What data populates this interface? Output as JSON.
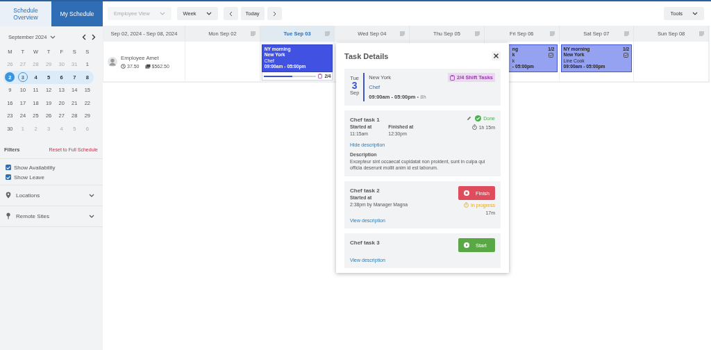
{
  "sidebar": {
    "tabs": [
      {
        "label": "Schedule Overview",
        "selected": false
      },
      {
        "label": "My Schedule",
        "selected": true
      }
    ],
    "calendar": {
      "month": "September 2024",
      "weekdays": [
        "M",
        "T",
        "W",
        "T",
        "F",
        "S",
        "S"
      ],
      "weeks": [
        {
          "selected": false,
          "days": [
            {
              "day": "26",
              "outside": true,
              "selected": false,
              "today": false
            },
            {
              "day": "27",
              "outside": true,
              "selected": false,
              "today": false
            },
            {
              "day": "28",
              "outside": true,
              "selected": false,
              "today": false
            },
            {
              "day": "29",
              "outside": true,
              "selected": false,
              "today": false
            },
            {
              "day": "30",
              "outside": true,
              "selected": false,
              "today": false
            },
            {
              "day": "31",
              "outside": true,
              "selected": false,
              "today": false
            },
            {
              "day": "1",
              "outside": false,
              "selected": false,
              "today": false
            }
          ]
        },
        {
          "selected": true,
          "days": [
            {
              "day": "2",
              "outside": false,
              "selected": true,
              "today": false
            },
            {
              "day": "3",
              "outside": false,
              "selected": false,
              "today": true
            },
            {
              "day": "4",
              "outside": false,
              "selected": false,
              "today": false
            },
            {
              "day": "5",
              "outside": false,
              "selected": false,
              "today": false
            },
            {
              "day": "6",
              "outside": false,
              "selected": false,
              "today": false
            },
            {
              "day": "7",
              "outside": false,
              "selected": false,
              "today": false
            },
            {
              "day": "8",
              "outside": false,
              "selected": false,
              "today": false
            }
          ]
        },
        {
          "selected": false,
          "days": [
            {
              "day": "9",
              "outside": false,
              "selected": false,
              "today": false
            },
            {
              "day": "10",
              "outside": false,
              "selected": false,
              "today": false
            },
            {
              "day": "11",
              "outside": false,
              "selected": false,
              "today": false
            },
            {
              "day": "12",
              "outside": false,
              "selected": false,
              "today": false
            },
            {
              "day": "13",
              "outside": false,
              "selected": false,
              "today": false
            },
            {
              "day": "14",
              "outside": false,
              "selected": false,
              "today": false
            },
            {
              "day": "15",
              "outside": false,
              "selected": false,
              "today": false
            }
          ]
        },
        {
          "selected": false,
          "days": [
            {
              "day": "16",
              "outside": false,
              "selected": false,
              "today": false
            },
            {
              "day": "17",
              "outside": false,
              "selected": false,
              "today": false
            },
            {
              "day": "18",
              "outside": false,
              "selected": false,
              "today": false
            },
            {
              "day": "19",
              "outside": false,
              "selected": false,
              "today": false
            },
            {
              "day": "20",
              "outside": false,
              "selected": false,
              "today": false
            },
            {
              "day": "21",
              "outside": false,
              "selected": false,
              "today": false
            },
            {
              "day": "22",
              "outside": false,
              "selected": false,
              "today": false
            }
          ]
        },
        {
          "selected": false,
          "days": [
            {
              "day": "23",
              "outside": false,
              "selected": false,
              "today": false
            },
            {
              "day": "24",
              "outside": false,
              "selected": false,
              "today": false
            },
            {
              "day": "25",
              "outside": false,
              "selected": false,
              "today": false
            },
            {
              "day": "26",
              "outside": false,
              "selected": false,
              "today": false
            },
            {
              "day": "27",
              "outside": false,
              "selected": false,
              "today": false
            },
            {
              "day": "28",
              "outside": false,
              "selected": false,
              "today": false
            },
            {
              "day": "29",
              "outside": false,
              "selected": false,
              "today": false
            }
          ]
        },
        {
          "selected": false,
          "days": [
            {
              "day": "30",
              "outside": false,
              "selected": false,
              "today": false
            },
            {
              "day": "1",
              "outside": true,
              "selected": false,
              "today": false
            },
            {
              "day": "2",
              "outside": true,
              "selected": false,
              "today": false
            },
            {
              "day": "3",
              "outside": true,
              "selected": false,
              "today": false
            },
            {
              "day": "4",
              "outside": true,
              "selected": false,
              "today": false
            },
            {
              "day": "5",
              "outside": true,
              "selected": false,
              "today": false
            },
            {
              "day": "6",
              "outside": true,
              "selected": false,
              "today": false
            }
          ]
        }
      ]
    },
    "filters": {
      "title": "Filters",
      "reset": "Reset to Full Schedule",
      "toggles": [
        {
          "label": "Show Availability",
          "checked": true
        },
        {
          "label": "Show Leave",
          "checked": true
        }
      ],
      "sections": [
        {
          "kind": "location",
          "label": "Locations",
          "expanded": false
        },
        {
          "kind": "pin",
          "label": "Remote Sites",
          "expanded": false
        }
      ]
    }
  },
  "toolbar": {
    "view": {
      "label": "Employee View",
      "disabled": true
    },
    "range": {
      "label": "Week",
      "disabled": false
    },
    "today": "Today",
    "tools": "Tools"
  },
  "schedule": {
    "range": "Sep 02, 2024 - Sep 08, 2024",
    "employee": {
      "name": "Employee Amet",
      "hours": "37.50",
      "pay": "$562.50"
    },
    "columns": [
      {
        "label": "Mon Sep 02",
        "selected": false
      },
      {
        "label": "Tue Sep 03",
        "selected": true,
        "shifts": [
          {
            "kind": "full",
            "title": "NY morning",
            "location": "New York",
            "role": "Chef",
            "time": "09:00am - 05:00pm",
            "tasks": "2/4",
            "selected": true,
            "level": 0.55
          }
        ]
      },
      {
        "label": "Wed Sep 04",
        "selected": false
      },
      {
        "label": "Thu Sep 05",
        "selected": false
      },
      {
        "label": "Fri Sep 06",
        "selected": false,
        "shifts": [
          {
            "kind": "covered",
            "title": "ng",
            "location": "k",
            "role": "k",
            "time": "- 05:00pm",
            "tasks": "1/2",
            "selected": false
          }
        ]
      },
      {
        "label": "Sat Sep 07",
        "selected": false,
        "shifts": [
          {
            "kind": "full",
            "title": "NY morning",
            "location": "New York",
            "role": "Line Cook",
            "time": "09:00am - 05:00pm",
            "tasks": "1/2",
            "selected": false
          }
        ]
      },
      {
        "label": "Sun Sep 08",
        "selected": false
      }
    ]
  },
  "task_details": {
    "title": "Task Details",
    "shift": {
      "weekday": "Tue",
      "day": "3",
      "month": "Sep",
      "location": "New York",
      "role": "Chef",
      "time": "09:00am - 05:00pm",
      "duration": "• 8h",
      "badge": "2/4 Shift Tasks"
    },
    "tasks": [
      {
        "kind": "done",
        "name": "Chef task 1",
        "status": "Done",
        "elapsed": "1h 15m",
        "started_label": "Started at",
        "started": "11:15am",
        "finished_label": "Finished at",
        "finished": "12:30pm",
        "link": "Hide description",
        "description_title": "Description",
        "description": "Excepteur sint occaecat cupidatat non proident, sunt in culpa qui officia deserunt mollit anim id est laborum."
      },
      {
        "kind": "in_progress",
        "name": "Chef task 2",
        "button": "Finish",
        "status": "In progress",
        "elapsed": "17m",
        "started_label": "Started at",
        "started": "2:38pm by Manager Magna",
        "link": "View description"
      },
      {
        "kind": "not_started",
        "name": "Chef task 3",
        "button": "Start",
        "link": "View description"
      }
    ]
  }
}
